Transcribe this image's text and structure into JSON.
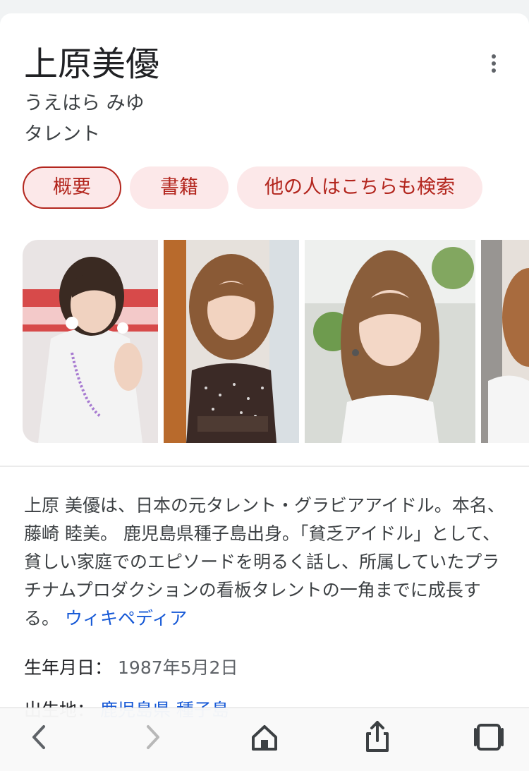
{
  "entity": {
    "title": "上原美優",
    "reading": "うえはら みゆ",
    "category": "タレント"
  },
  "chips": [
    {
      "label": "概要",
      "active": true
    },
    {
      "label": "書籍",
      "active": false
    },
    {
      "label": "他の人はこちらも検索",
      "active": false
    }
  ],
  "photos": [
    {
      "name": "photo-1"
    },
    {
      "name": "photo-2"
    },
    {
      "name": "photo-3"
    },
    {
      "name": "photo-4"
    }
  ],
  "description": {
    "text": "上原 美優は、日本の元タレント・グラビアアイドル。本名、藤崎 睦美。 鹿児島県種子島出身。「貧乏アイドル」として、貧しい家庭でのエピソードを明るく話し、所属していたプラチナムプロダクションの看板タレントの一角までに成長する。",
    "source_link": "ウィキペディア"
  },
  "facts": {
    "birth_label": "生年月日：",
    "birth_value": "1987年5月2日",
    "birthplace_label": "出生地：",
    "birthplace_value": "鹿児島県 種子島"
  },
  "toolbar": {
    "icons": [
      "back-icon",
      "forward-icon",
      "home-icon",
      "share-icon",
      "tabs-icon"
    ]
  },
  "colors": {
    "chip_bg": "#fce8e9",
    "chip_text": "#b3261e",
    "link": "#1558d6"
  }
}
